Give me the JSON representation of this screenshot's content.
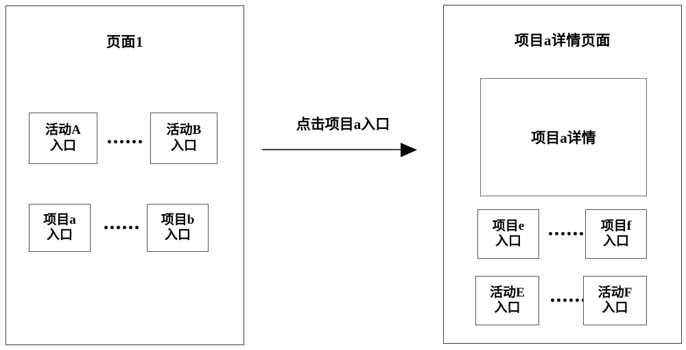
{
  "diagram": {
    "type": "flow-transition",
    "left_panel": {
      "title": "页面1",
      "rows": [
        {
          "name": "activity-row",
          "left_box": {
            "line1": "活动A",
            "line2": "入口"
          },
          "separator": "......",
          "right_box": {
            "line1": "活动B",
            "line2": "入口"
          }
        },
        {
          "name": "project-row",
          "left_box": {
            "line1": "项目a",
            "line2": "入口"
          },
          "separator": "......",
          "right_box": {
            "line1": "项目b",
            "line2": "入口"
          }
        }
      ]
    },
    "transition": {
      "label": "点击项目a入口",
      "arrow": "right-arrow"
    },
    "right_panel": {
      "title": "项目a详情页面",
      "detail_box": {
        "label": "项目a详情"
      },
      "rows": [
        {
          "name": "project-row",
          "left_box": {
            "line1": "项目e",
            "line2": "入口"
          },
          "separator": "......",
          "right_box": {
            "line1": "项目f",
            "line2": "入口"
          }
        },
        {
          "name": "activity-row",
          "left_box": {
            "line1": "活动E",
            "line2": "入口"
          },
          "separator": "......",
          "right_box": {
            "line1": "活动F",
            "line2": "入口"
          }
        }
      ]
    },
    "colors": {
      "background": "#ffffff",
      "stroke": "#3a3a3a",
      "box_stroke": "#555555",
      "text": "#000000"
    }
  }
}
